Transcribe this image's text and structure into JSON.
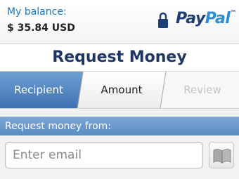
{
  "header": {
    "balance_label": "My balance:",
    "balance_amount": "$ 35.84 USD",
    "logo_pay": "Pay",
    "logo_pal": "Pal",
    "logo_tm": "™"
  },
  "page": {
    "title": "Request Money"
  },
  "steps": [
    {
      "label": "Recipient",
      "state": "active"
    },
    {
      "label": "Amount",
      "state": "upcoming"
    },
    {
      "label": "Review",
      "state": "disabled"
    }
  ],
  "form": {
    "section_label": "Request money from:",
    "email_placeholder": "Enter email",
    "email_value": ""
  },
  "icons": {
    "lock": "lock-icon",
    "contacts": "address-book-icon"
  },
  "colors": {
    "brand_dark": "#1e3e78",
    "brand_light": "#2a8ed6",
    "active_tab": "#4f82bd",
    "section_header": "#6a97cb"
  }
}
